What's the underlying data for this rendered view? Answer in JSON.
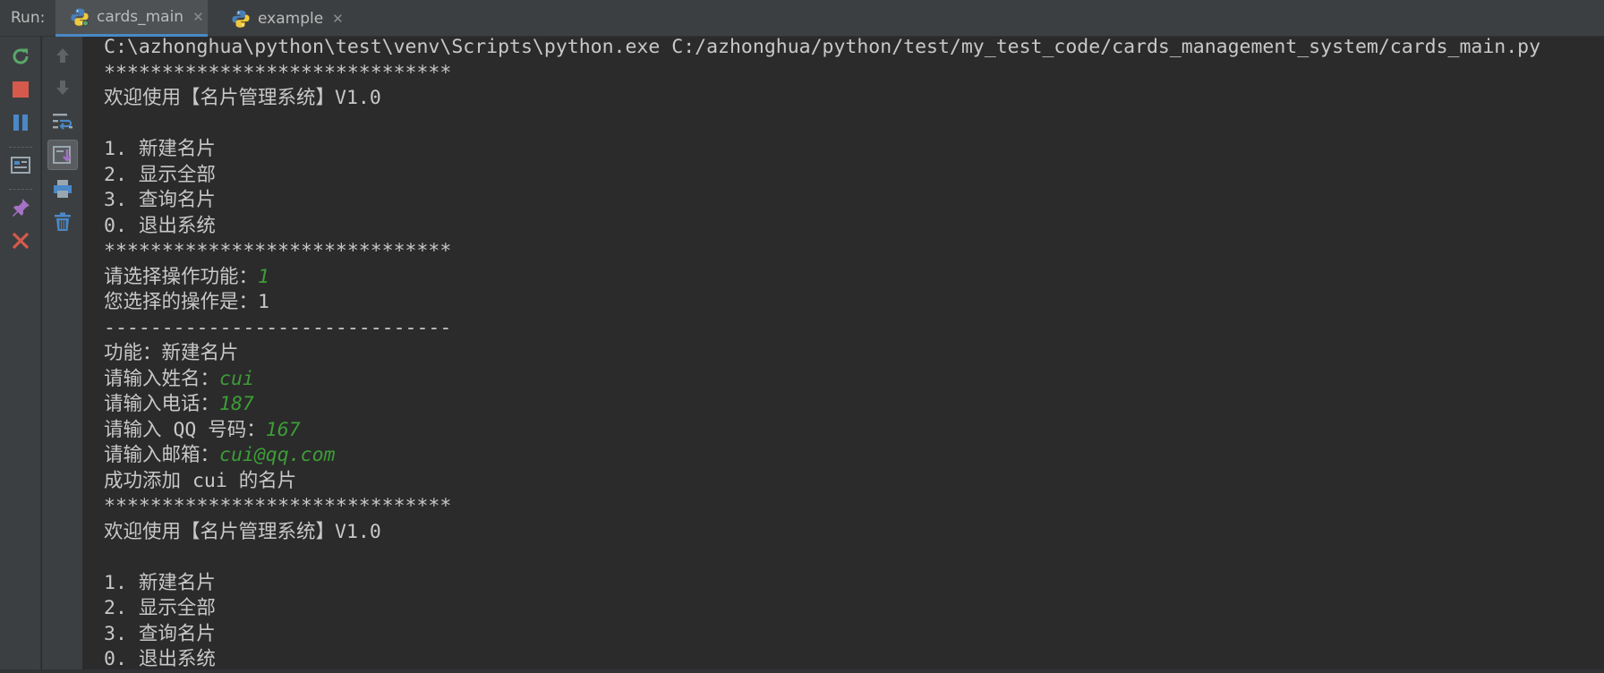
{
  "run_panel": {
    "label": "Run:",
    "tabs": [
      {
        "label": "cards_main",
        "active": true,
        "icon": "python-icon"
      },
      {
        "label": "example",
        "active": false,
        "icon": "python-icon"
      }
    ]
  },
  "toolbar_left": [
    "rerun-icon",
    "stop-icon",
    "pause-icon",
    "dump-threads-icon",
    "pin-tab-icon",
    "close-icon"
  ],
  "toolbar_right": [
    "up-arrow-icon",
    "down-arrow-icon",
    "soft-wrap-icon",
    "scroll-to-end-icon",
    "print-icon",
    "clear-all-icon"
  ],
  "colors": {
    "background": "#2b2b2b",
    "toolbar": "#3c3f41",
    "console_text": "#c8c8c8",
    "user_input": "#3d9c37",
    "stop_red": "#d55a4b",
    "rerun_green": "#59a869",
    "accent_blue": "#4a88c7"
  },
  "console": {
    "command": "C:\\azhonghua\\python\\test\\venv\\Scripts\\python.exe C:/azhonghua/python/test/my_test_code/cards_management_system/cards_main.py",
    "stars": "******************************",
    "dashes": "------------------------------",
    "welcome": "欢迎使用【名片管理系统】V1.0",
    "menu": [
      "1. 新建名片",
      "2. 显示全部",
      "3. 查询名片",
      "0. 退出系统"
    ],
    "prompt_choose": "请选择操作功能：",
    "input_choice": "1",
    "your_choice": "您选择的操作是：1",
    "function": "功能：新建名片",
    "prompt_name": "请输入姓名：",
    "input_name": "cui",
    "prompt_phone": "请输入电话：",
    "input_phone": "187",
    "prompt_qq": "请输入 QQ 号码：",
    "input_qq": "167",
    "prompt_email": "请输入邮箱：",
    "input_email": "cui@qq.com",
    "success": "成功添加 cui 的名片"
  }
}
